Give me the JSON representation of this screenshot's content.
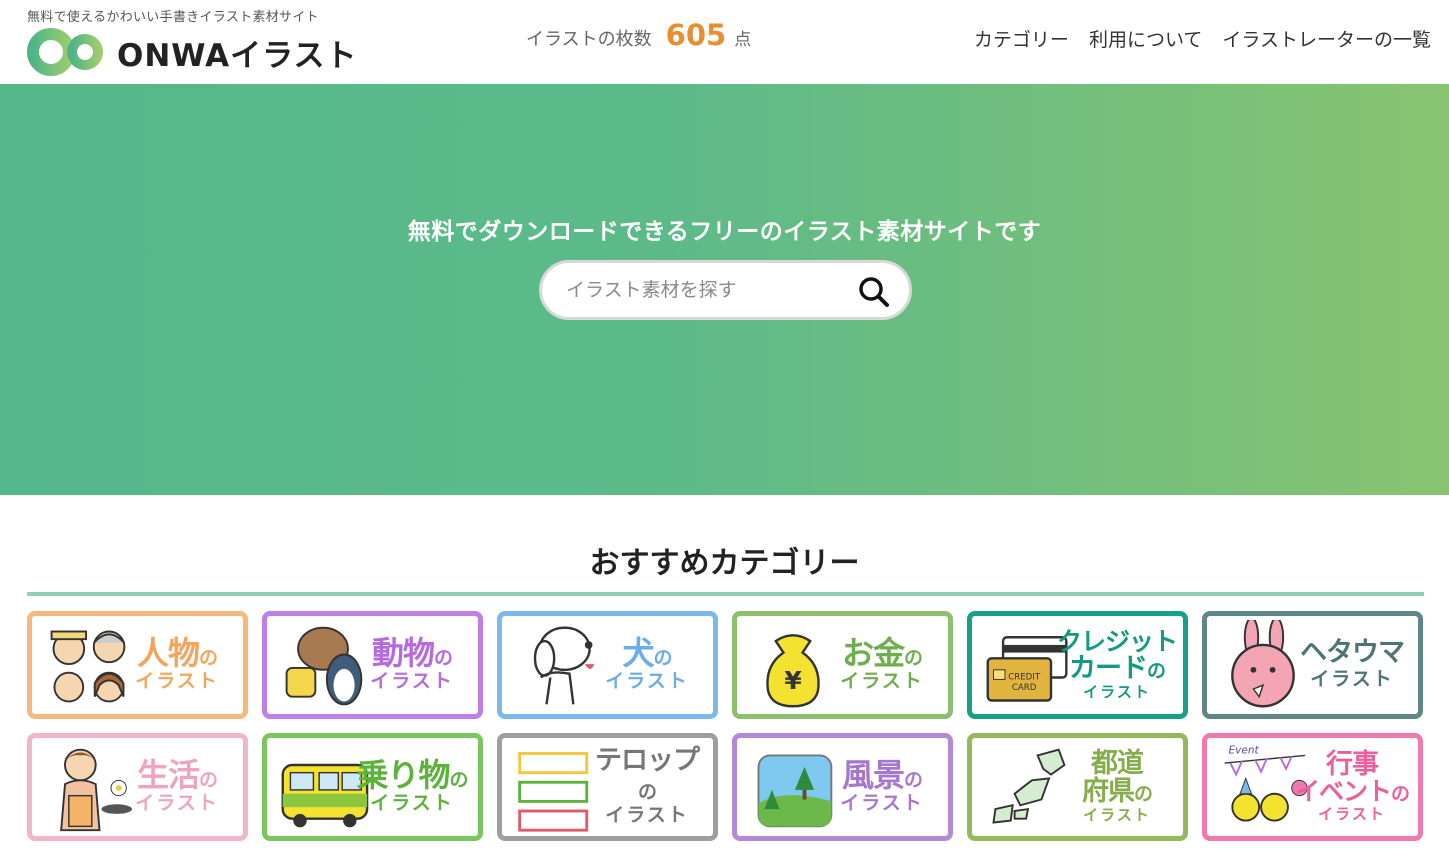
{
  "header": {
    "tagline": "無料で使えるかわいい手書きイラスト素材サイト",
    "logo_text": "ONWAイラスト",
    "count_label": "イラストの枚数",
    "count_value": "605",
    "count_unit": "点",
    "nav": [
      "カテゴリー",
      "利用について",
      "イラストレーターの一覧"
    ]
  },
  "hero": {
    "title": "無料でダウンロードできるフリーのイラスト素材サイトです",
    "search_placeholder": "イラスト素材を探す",
    "colors": {
      "gradient_start": "#55b88a",
      "gradient_end": "#88c470"
    }
  },
  "section": {
    "title": "おすすめカテゴリー",
    "rule_color": "#8ed1b4"
  },
  "categories": [
    {
      "main": "人物",
      "suffix": "の",
      "sub": "イラスト",
      "border": "#f5b97d",
      "color": "#f4a55c",
      "icon": "people-icon"
    },
    {
      "main": "動物",
      "suffix": "の",
      "sub": "イラスト",
      "border": "#c07ee8",
      "color": "#b46be0",
      "icon": "animals-icon"
    },
    {
      "main": "犬",
      "suffix": "の",
      "sub": "イラスト",
      "border": "#7cb8ee",
      "color": "#6aaee9",
      "icon": "dog-icon"
    },
    {
      "main": "お金",
      "suffix": "の",
      "sub": "イラスト",
      "border": "#8dc06e",
      "color": "#6fae4d",
      "icon": "money-bag-icon"
    },
    {
      "main": "クレジット",
      "main2": "カード",
      "suffix": "の",
      "sub": "イラスト",
      "border": "#16a08a",
      "color": "#139985",
      "icon": "credit-card-icon"
    },
    {
      "main": "ヘタウマ",
      "suffix": "",
      "sub": "イラスト",
      "border": "#5f8789",
      "color": "#4e7476",
      "icon": "rabbit-face-icon"
    },
    {
      "main": "生活",
      "suffix": "の",
      "sub": "イラスト",
      "border": "#f1b7c8",
      "color": "#f0a4bb",
      "icon": "cooking-woman-icon"
    },
    {
      "main": "乗り物",
      "suffix": "の",
      "sub": "イラスト",
      "border": "#7bc65f",
      "color": "#5cb23d",
      "icon": "bus-icon"
    },
    {
      "main": "テロップ",
      "suffix": "の",
      "sub": "イラスト",
      "border": "#9e9e9e",
      "color": "#777777",
      "icon": "caption-frames-icon"
    },
    {
      "main": "風景",
      "suffix": "の",
      "sub": "イラスト",
      "border": "#b48ad6",
      "color": "#a678cc",
      "icon": "landscape-icon"
    },
    {
      "main": "都道",
      "main2": "府県",
      "suffix": "の",
      "sub": "イラスト",
      "border": "#93b95a",
      "color": "#86ad4b",
      "icon": "japan-map-icon"
    },
    {
      "main": "行事",
      "main2": "イベント",
      "suffix": "の",
      "sub": "イラスト",
      "border": "#f07aaf",
      "color": "#ec5f9d",
      "icon": "event-party-icon",
      "art_text": "Event"
    }
  ]
}
